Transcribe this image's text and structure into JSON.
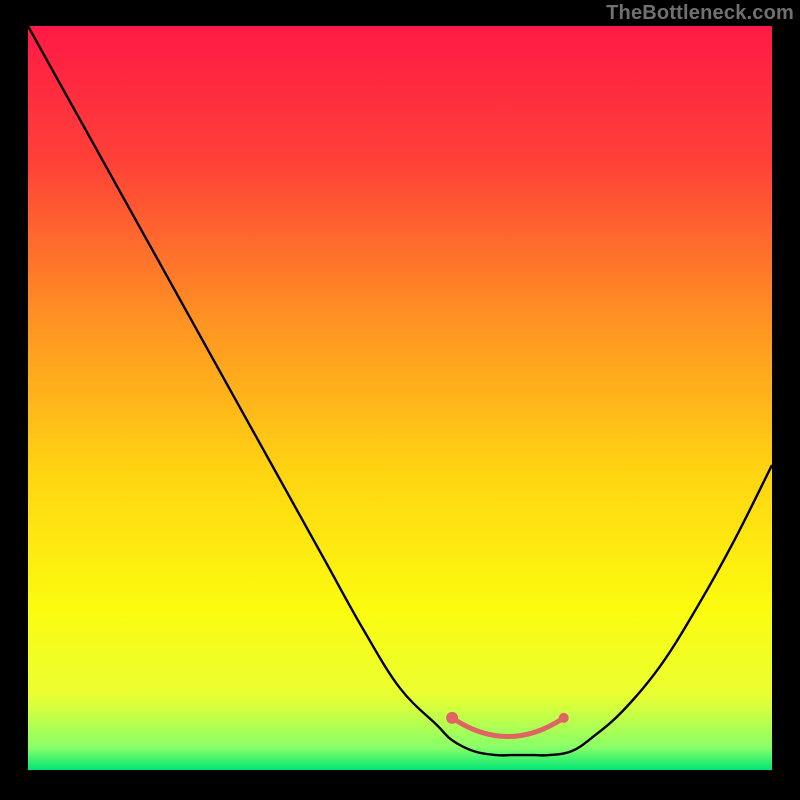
{
  "watermark": "TheBottleneck.com",
  "chart_data": {
    "type": "line",
    "title": "",
    "xlabel": "",
    "ylabel": "",
    "xlim": [
      0,
      100
    ],
    "ylim": [
      0,
      100
    ],
    "x": [
      0,
      5,
      10,
      15,
      20,
      25,
      30,
      35,
      40,
      45,
      50,
      55,
      57,
      60,
      63,
      65,
      68,
      70,
      73,
      76,
      80,
      85,
      90,
      95,
      100
    ],
    "values": [
      100,
      91,
      82,
      73,
      64,
      55,
      46,
      37,
      28,
      19,
      11,
      6,
      4,
      2.5,
      2,
      2,
      2,
      2,
      2.5,
      4.5,
      8,
      14,
      22,
      31,
      41
    ],
    "marker_points_x": [
      57,
      72
    ],
    "marker_points_y": [
      7,
      7
    ],
    "gradient_stops": [
      {
        "offset": 0,
        "color": "#ff1946"
      },
      {
        "offset": 18,
        "color": "#ff4038"
      },
      {
        "offset": 40,
        "color": "#ff9422"
      },
      {
        "offset": 60,
        "color": "#ffd412"
      },
      {
        "offset": 78,
        "color": "#fcfb0e"
      },
      {
        "offset": 90,
        "color": "#eaff32"
      },
      {
        "offset": 97,
        "color": "#88ff68"
      },
      {
        "offset": 100,
        "color": "#00e676"
      }
    ],
    "marker_color": "#e06464",
    "curve_color": "#000000"
  }
}
